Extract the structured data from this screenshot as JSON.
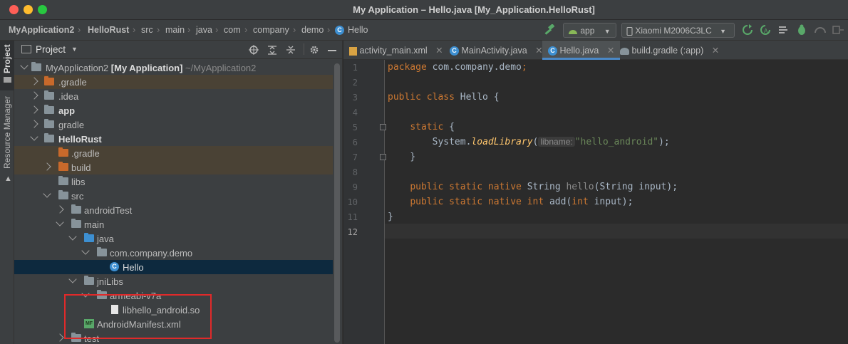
{
  "window": {
    "title": "My Application – Hello.java [My_Application.HelloRust]"
  },
  "breadcrumb": [
    "MyApplication2",
    "HelloRust",
    "src",
    "main",
    "java",
    "com",
    "company",
    "demo",
    "Hello"
  ],
  "toolbar": {
    "run_config": "app",
    "device": "Xiaomi M2006C3LC"
  },
  "side_tabs": {
    "project": "Project",
    "resource_manager": "Resource Manager"
  },
  "project_panel": {
    "title": "Project"
  },
  "tree": [
    {
      "label": "MyApplication2",
      "bold": true,
      "extra": "[My Application]",
      "path": "~/MyApplication2"
    },
    {
      "label": ".gradle"
    },
    {
      "label": ".idea"
    },
    {
      "label": "app"
    },
    {
      "label": "gradle"
    },
    {
      "label": "HelloRust"
    },
    {
      "label": ".gradle"
    },
    {
      "label": "build"
    },
    {
      "label": "libs"
    },
    {
      "label": "src"
    },
    {
      "label": "androidTest"
    },
    {
      "label": "main"
    },
    {
      "label": "java"
    },
    {
      "label": "com.company.demo"
    },
    {
      "label": "Hello"
    },
    {
      "label": "jniLibs"
    },
    {
      "label": "armeabi-v7a"
    },
    {
      "label": "libhello_android.so"
    },
    {
      "label": "AndroidManifest.xml"
    },
    {
      "label": "test"
    }
  ],
  "tabs": [
    {
      "label": "activity_main.xml"
    },
    {
      "label": "MainActivity.java"
    },
    {
      "label": "Hello.java",
      "active": true
    },
    {
      "label": "build.gradle (:app)"
    }
  ],
  "code": {
    "pkg_kw": "package",
    "pkg_name": "com.company.demo",
    "l3_kw": "public class",
    "l3_name": "Hello",
    "l3_brace": "{",
    "l5_kw": "static",
    "l5_brace": "{",
    "l6_pre": "System.",
    "l6_method": "loadLibrary",
    "l6_paren": "(",
    "l6_hint": "libname:",
    "l6_str": "\"hello_android\"",
    "l6_end": ");",
    "l7": "}",
    "l9_kw": "public static native",
    "l9_type": "String",
    "l9_fn": "hello",
    "l9_args": "(String input);",
    "l10_kw": "public static native int",
    "l10_fn": "add",
    "l10_paren": "(",
    "l10_kw2": "int",
    "l10_args": "input);",
    "l11": "}"
  },
  "line_numbers": [
    "1",
    "2",
    "3",
    "4",
    "5",
    "6",
    "7",
    "8",
    "9",
    "10",
    "11",
    "12"
  ],
  "colors": {
    "accent": "#4a88c7",
    "keyword": "#cc7832",
    "string": "#6a8759",
    "highlight_box": "#e02a2a"
  }
}
